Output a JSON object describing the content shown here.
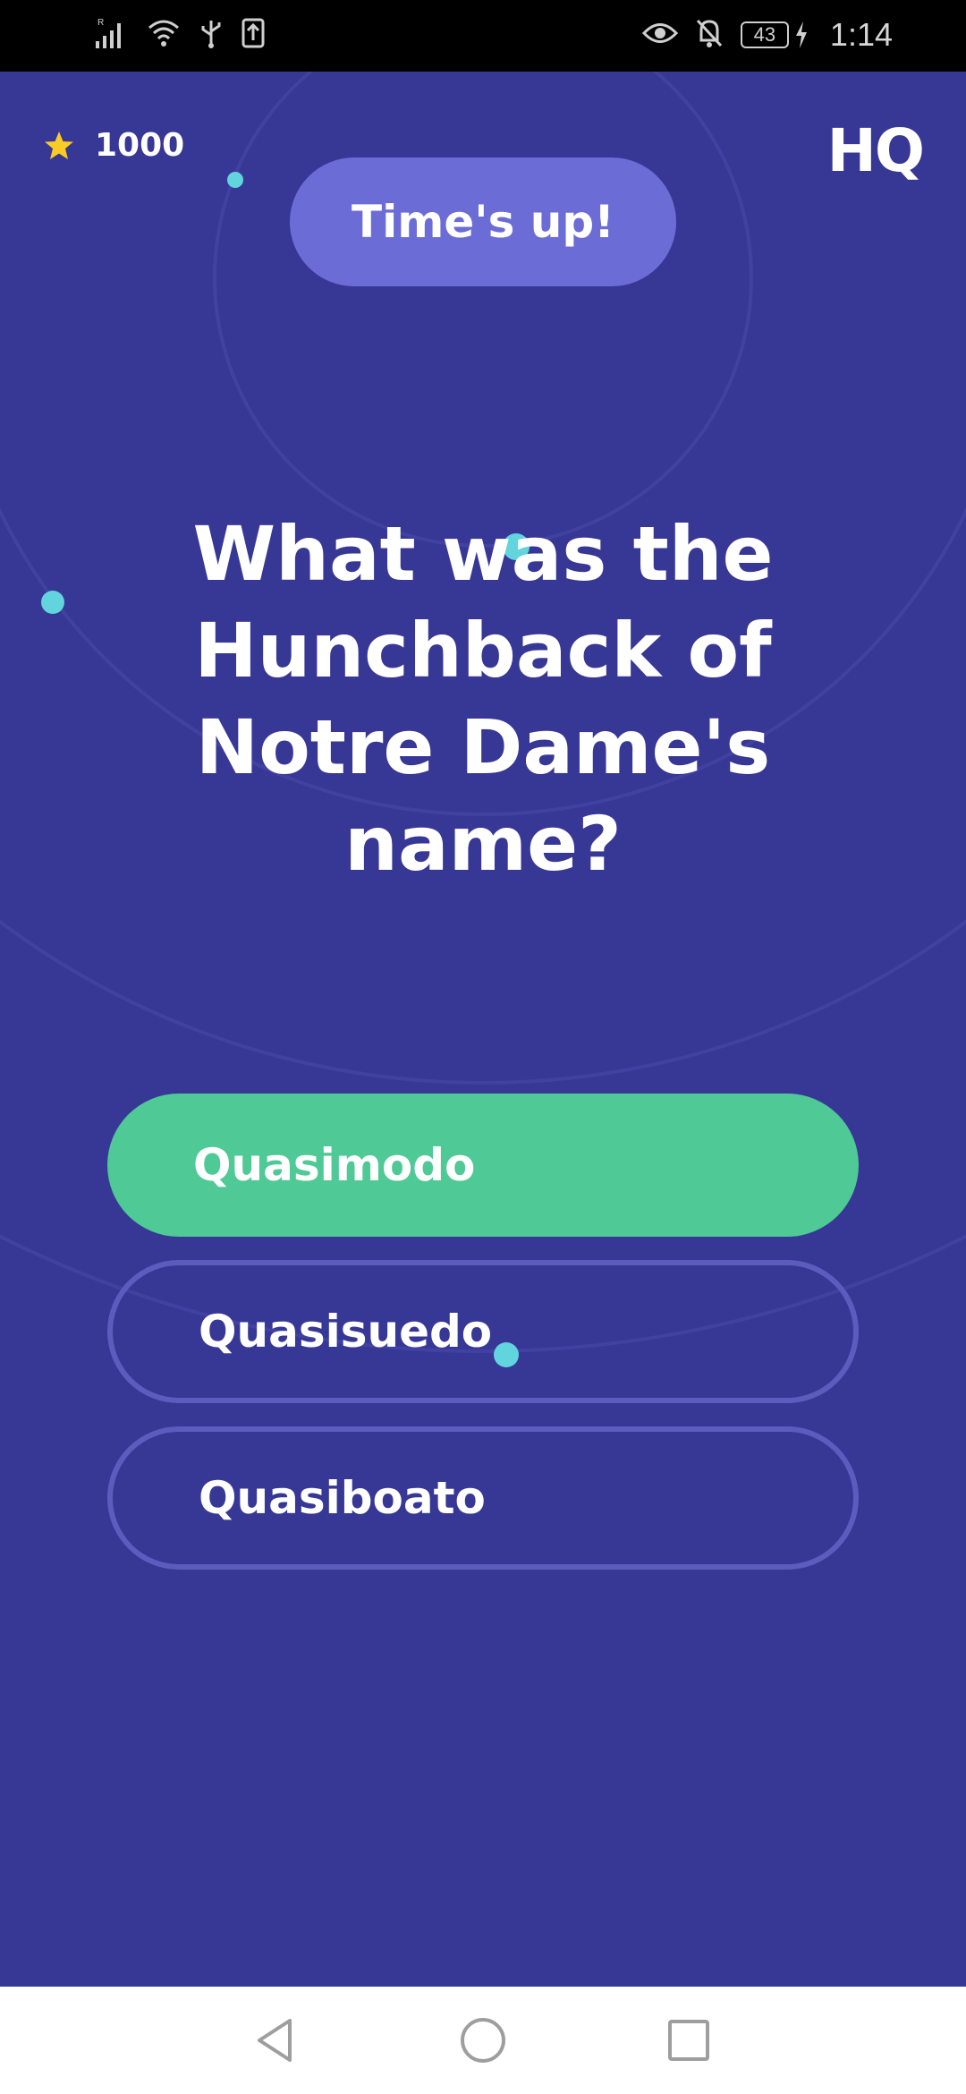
{
  "status_bar": {
    "time": "1:14",
    "battery_level": "43",
    "signal_label": "R"
  },
  "header": {
    "score": "1000",
    "logo": "HQ",
    "timer_label": "Time's up!"
  },
  "question": {
    "text": "What was the Hunchback of Notre Dame's name?"
  },
  "answers": [
    {
      "label": "Quasimodo",
      "state": "correct"
    },
    {
      "label": "Quasisuedo",
      "state": "normal"
    },
    {
      "label": "Quasiboato",
      "state": "normal"
    }
  ],
  "colors": {
    "background": "#373796",
    "timer_pill": "#6c6cd6",
    "correct_answer": "#4fc995",
    "answer_outline": "#5c5cbf",
    "dot": "#62d4dd",
    "star": "#f8cc24"
  },
  "icons": {
    "status_left": [
      "signal-icon",
      "wifi-icon",
      "usb-icon",
      "upload-icon"
    ],
    "status_right": [
      "eye-icon",
      "bell-off-icon",
      "battery-icon",
      "charging-icon"
    ],
    "score": "star-icon",
    "nav": [
      "back-icon",
      "home-icon",
      "recents-icon"
    ]
  }
}
